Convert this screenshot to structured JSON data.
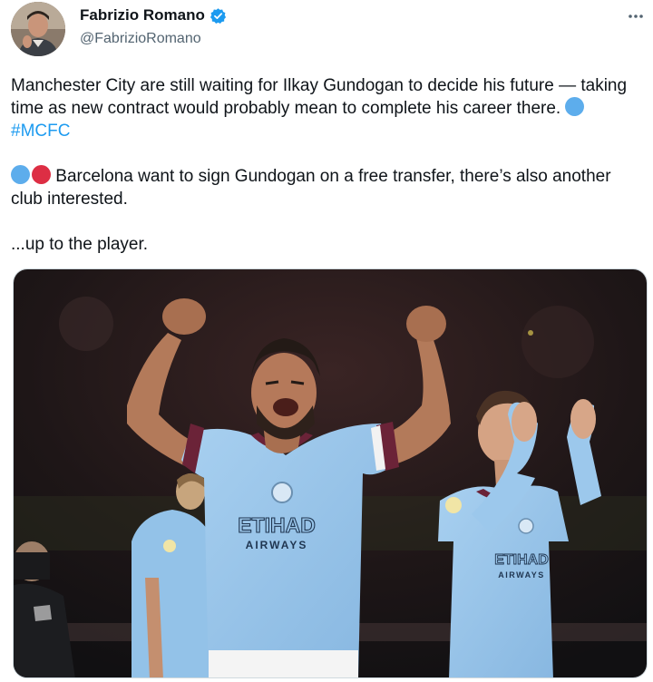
{
  "tweet": {
    "author": {
      "display_name": "Fabrizio Romano",
      "handle": "@FabrizioRomano",
      "verified": true
    },
    "text": {
      "para1_main": "Manchester City are still waiting for Ilkay Gundogan to decide his future — taking time as new contract would probably mean to complete his career there. ",
      "para1_hashtag": "#MCFC",
      "para2": " Barcelona want to sign Gundogan on a free transfer, there’s also another club interested.",
      "para3": "...up to the player."
    },
    "emoji": {
      "city_blue": "blue-circle",
      "barca_red": "red-circle"
    },
    "media": {
      "shirt_sponsor_line1": "ETIHAD",
      "shirt_sponsor_line2": "AIRWAYS",
      "shirt_sponsor_small_line1": "ETIHAD",
      "shirt_sponsor_small_line2": "AIRWAYS"
    },
    "colors": {
      "link": "#1d9bf0",
      "verified": "#1d9bf0",
      "shirt": "#9cc8ec",
      "text": "#0f1419",
      "secondary": "#536471"
    }
  }
}
